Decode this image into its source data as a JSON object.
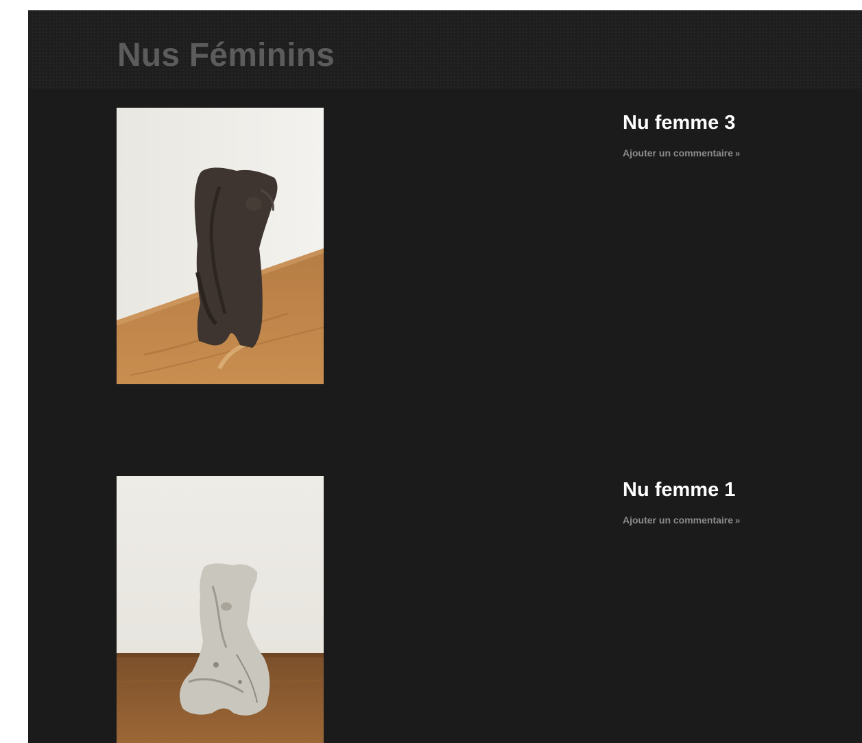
{
  "header": {
    "title": "Nus Féminins"
  },
  "posts": [
    {
      "title": "Nu femme 3",
      "comment_link": "Ajouter un commentaire",
      "comment_suffix": "»",
      "image": "dark-bronze-female-torso-sculpture"
    },
    {
      "title": "Nu femme 1",
      "comment_link": "Ajouter un commentaire",
      "comment_suffix": "»",
      "image": "white-stone-seated-female-sculpture"
    }
  ],
  "colors": {
    "page_background": "#1b1b1b",
    "header_title": "#5c5c5c",
    "post_title": "#ffffff",
    "comment_link": "#8c8c8c"
  }
}
